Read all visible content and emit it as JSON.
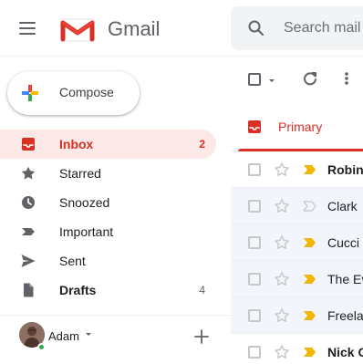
{
  "app": {
    "title": "Gmail"
  },
  "search": {
    "placeholder": "Search mail"
  },
  "compose": {
    "label": "Compose"
  },
  "sidebar": {
    "items": [
      {
        "label": "Inbox",
        "count": "2"
      },
      {
        "label": "Starred",
        "count": ""
      },
      {
        "label": "Snoozed",
        "count": ""
      },
      {
        "label": "Important",
        "count": ""
      },
      {
        "label": "Sent",
        "count": ""
      },
      {
        "label": "Drafts",
        "count": "4"
      }
    ]
  },
  "user": {
    "name": "Adam"
  },
  "tabs": {
    "primary": "Primary"
  },
  "emails": [
    {
      "sender": "Robin",
      "read": false
    },
    {
      "sender": "Clark",
      "read": true
    },
    {
      "sender": "Cucci",
      "read": true
    },
    {
      "sender": "The Ev",
      "read": true
    },
    {
      "sender": "Freela",
      "read": true
    },
    {
      "sender": "Nick C",
      "read": false
    }
  ],
  "colors": {
    "accent": "#d93025",
    "active_bg": "#fce8e6",
    "text": "#202124",
    "muted": "#5f6368",
    "important": "#f4b400",
    "read_row_bg": "#f2f6fc",
    "status_online": "#34a853"
  },
  "icons": {
    "menu": "menu-icon",
    "gmail": "gmail-logo",
    "search": "search-icon",
    "compose": "plus-icon",
    "inbox": "inbox-icon",
    "starred": "star-icon",
    "snoozed": "clock-icon",
    "important": "important-icon",
    "sent": "send-icon",
    "drafts": "draft-icon",
    "refresh": "refresh-icon",
    "more": "more-vert-icon",
    "primary": "inbox-icon",
    "add_account": "plus-icon"
  }
}
